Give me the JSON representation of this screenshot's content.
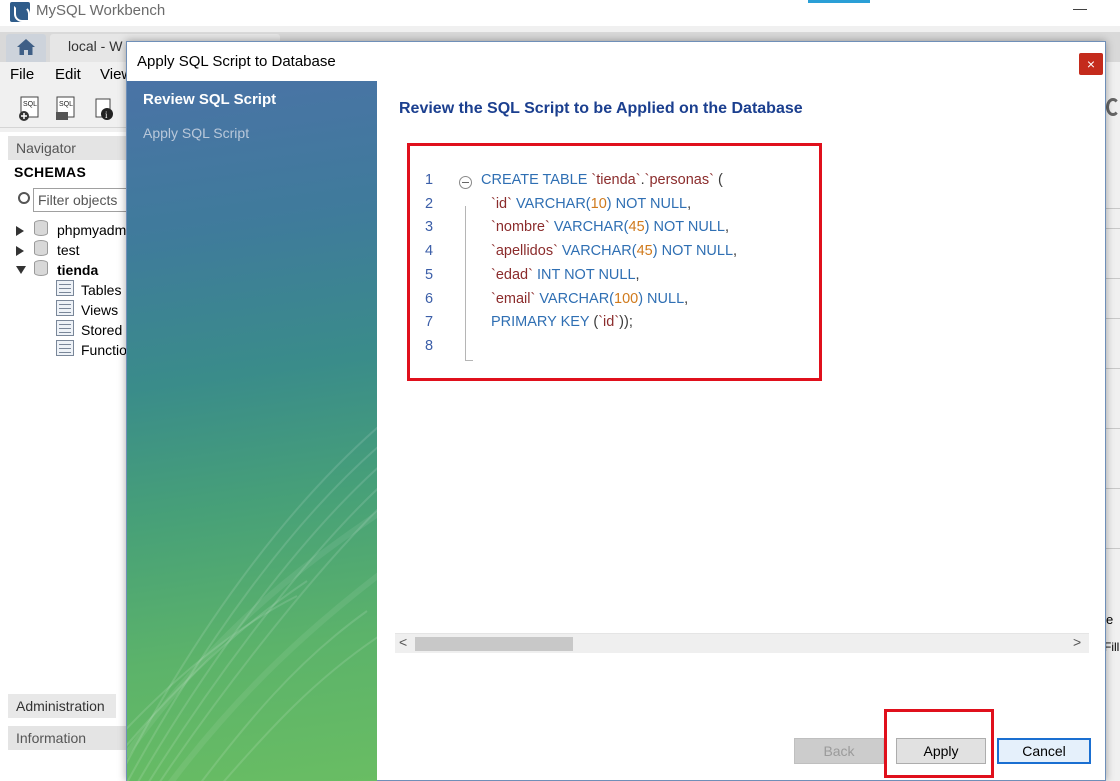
{
  "window": {
    "title": "MySQL Workbench",
    "minimize_glyph": "—"
  },
  "tabs": {
    "home_icon": "home-icon",
    "connection_tab_label": "local - W"
  },
  "menu": {
    "items": [
      "File",
      "Edit",
      "View"
    ]
  },
  "navigator": {
    "header": "Navigator",
    "schemas_label": "SCHEMAS",
    "filter_placeholder": "Filter objects",
    "schemas": [
      {
        "name": "phpmyadm",
        "expanded": false
      },
      {
        "name": "test",
        "expanded": false
      },
      {
        "name": "tienda",
        "expanded": true
      }
    ],
    "tienda_children": [
      "Tables",
      "Views",
      "Stored",
      "Functio"
    ],
    "administration_tab": "Administration",
    "information_header": "Information"
  },
  "right_strip": {
    "letter": "e",
    "fill_text": "Fill"
  },
  "dialog": {
    "title": "Apply SQL Script to Database",
    "close_glyph": "×",
    "steps": [
      {
        "label": "Review SQL Script",
        "active": true
      },
      {
        "label": "Apply SQL Script",
        "active": false
      }
    ],
    "heading": "Review the SQL Script to be Applied on the Database",
    "code_lines": [
      {
        "n": "1",
        "tokens": [
          [
            "kw",
            "CREATE TABLE "
          ],
          [
            "ident",
            "`tienda`"
          ],
          [
            "punc",
            "."
          ],
          [
            "ident",
            "`personas`"
          ],
          [
            "punc",
            " ("
          ]
        ]
      },
      {
        "n": "2",
        "tokens": [
          [
            "ident",
            "`id`"
          ],
          [
            "kw",
            " VARCHAR("
          ],
          [
            "num",
            "10"
          ],
          [
            "kw",
            ") NOT NULL"
          ],
          [
            "punc",
            ","
          ]
        ]
      },
      {
        "n": "3",
        "tokens": [
          [
            "ident",
            "`nombre`"
          ],
          [
            "kw",
            " VARCHAR("
          ],
          [
            "num",
            "45"
          ],
          [
            "kw",
            ") NOT NULL"
          ],
          [
            "punc",
            ","
          ]
        ]
      },
      {
        "n": "4",
        "tokens": [
          [
            "ident",
            "`apellidos`"
          ],
          [
            "kw",
            " VARCHAR("
          ],
          [
            "num",
            "45"
          ],
          [
            "kw",
            ") NOT NULL"
          ],
          [
            "punc",
            ","
          ]
        ]
      },
      {
        "n": "5",
        "tokens": [
          [
            "ident",
            "`edad`"
          ],
          [
            "kw",
            " INT NOT NULL"
          ],
          [
            "punc",
            ","
          ]
        ]
      },
      {
        "n": "6",
        "tokens": [
          [
            "ident",
            "`email`"
          ],
          [
            "kw",
            " VARCHAR("
          ],
          [
            "num",
            "100"
          ],
          [
            "kw",
            ") NULL"
          ],
          [
            "punc",
            ","
          ]
        ]
      },
      {
        "n": "7",
        "tokens": [
          [
            "kw",
            "PRIMARY KEY "
          ],
          [
            "punc",
            "("
          ],
          [
            "ident",
            "`id`"
          ],
          [
            "punc",
            "));"
          ]
        ]
      },
      {
        "n": "8",
        "tokens": []
      }
    ],
    "buttons": {
      "back": "Back",
      "apply": "Apply",
      "cancel": "Cancel"
    },
    "scroll_left": "<",
    "scroll_right": ">"
  },
  "colors": {
    "highlight_box": "#e0101c",
    "heading": "#1b3f8f",
    "keyword": "#2f6fb3",
    "identifier": "#8b2c2c",
    "number": "#d07a1c"
  }
}
